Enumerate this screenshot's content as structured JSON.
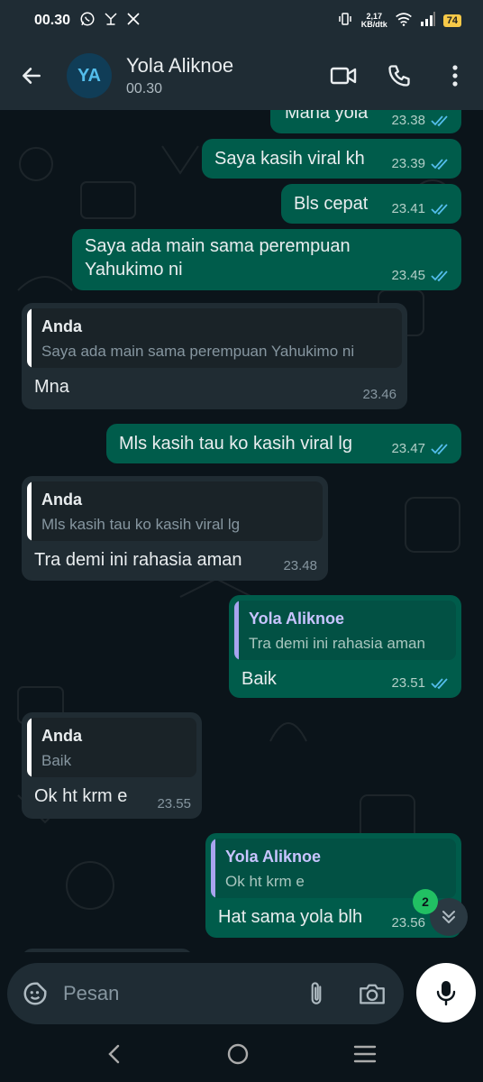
{
  "status_bar": {
    "time": "00.30",
    "speed_top": "2,17",
    "speed_bottom": "KB/dtk",
    "battery": "74"
  },
  "header": {
    "avatar_initials": "YA",
    "contact_name": "Yola Aliknoe",
    "contact_status": "00.30"
  },
  "messages": [
    {
      "dir": "out",
      "text": "Mana yola",
      "time": "23.38"
    },
    {
      "dir": "out",
      "text": "Saya kasih viral kh",
      "time": "23.39"
    },
    {
      "dir": "out",
      "text": "Bls cepat",
      "time": "23.41"
    },
    {
      "dir": "out",
      "text_line1": "Saya ada main sama perempuan",
      "text_line2": "Yahukimo ni",
      "time": "23.45"
    },
    {
      "dir": "in",
      "quote_name": "Anda",
      "quote_text": "Saya ada main sama perempuan Yahukimo ni",
      "text": "Mna",
      "time": "23.46"
    },
    {
      "dir": "out",
      "text": "Mls kasih tau ko kasih viral lg",
      "time": "23.47"
    },
    {
      "dir": "in",
      "quote_name": "Anda",
      "quote_text": "Mls kasih tau ko kasih viral lg",
      "text": "Tra demi ini rahasia aman",
      "time": "23.48"
    },
    {
      "dir": "out",
      "quote_name": "Yola Aliknoe",
      "quote_text": "Tra demi ini rahasia aman",
      "text": "Baik",
      "time": "23.51"
    },
    {
      "dir": "in",
      "quote_name": "Anda",
      "quote_text": "Baik",
      "text": "Ok ht krm e",
      "time": "23.55"
    },
    {
      "dir": "out",
      "quote_name": "Yola Aliknoe",
      "quote_text": "Ok ht krm e",
      "text": "Hat sama yola blh",
      "time": "23.56"
    }
  ],
  "unread_count": "2",
  "composer": {
    "placeholder": "Pesan"
  },
  "colors": {
    "outgoing_bubble": "#005c4b",
    "incoming_bubble": "#202c33",
    "read_ticks": "#53bdeb",
    "badge": "#21c063"
  },
  "icons": [
    "whatsapp-icon",
    "network-icon",
    "x-icon",
    "vibrate-icon",
    "wifi-icon",
    "signal-icon",
    "back-arrow-icon",
    "video-call-icon",
    "phone-icon",
    "more-icon",
    "double-check-icon",
    "chevron-double-down-icon",
    "sticker-icon",
    "attach-icon",
    "camera-icon",
    "mic-icon",
    "nav-back-icon",
    "nav-home-icon",
    "nav-menu-icon"
  ]
}
